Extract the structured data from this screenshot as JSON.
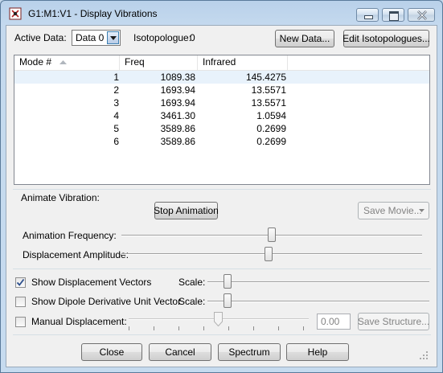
{
  "window": {
    "title": "G1:M1:V1 - Display Vibrations"
  },
  "top": {
    "active_data_label": "Active Data:",
    "active_data_value": "Data 0",
    "isotopologue_label": "Isotopologue:",
    "isotopologue_value": "0",
    "new_data_label": "New Data...",
    "edit_isotopologues_label": "Edit Isotopologues..."
  },
  "table": {
    "columns": [
      "Mode #",
      "Freq",
      "Infrared"
    ],
    "rows": [
      {
        "mode": "1",
        "freq": "1089.38",
        "infrared": "145.4275"
      },
      {
        "mode": "2",
        "freq": "1693.94",
        "infrared": "13.5571"
      },
      {
        "mode": "3",
        "freq": "1693.94",
        "infrared": "13.5571"
      },
      {
        "mode": "4",
        "freq": "3461.30",
        "infrared": "1.0594"
      },
      {
        "mode": "5",
        "freq": "3589.86",
        "infrared": "0.2699"
      },
      {
        "mode": "6",
        "freq": "3589.86",
        "infrared": "0.2699"
      }
    ]
  },
  "animate": {
    "group_label": "Animate Vibration:",
    "stop_animation_label": "Stop Animation",
    "save_movie_label": "Save Movie...",
    "frequency_label": "Animation Frequency:",
    "frequency_level": 0.5,
    "amplitude_label": "Displacement Amplitude:",
    "amplitude_level": 0.49
  },
  "options": {
    "show_vectors_label": "Show Displacement Vectors",
    "show_vectors_checked": true,
    "show_vectors_scale_label": "Scale:",
    "show_dipole_label": "Show Dipole Derivative Unit Vector",
    "show_dipole_checked": false,
    "show_dipole_scale_label": "Scale:",
    "manual_label": "Manual Displacement:",
    "manual_checked": false,
    "manual_value": "0.00",
    "save_structure_label": "Save Structure..."
  },
  "footer": {
    "close_label": "Close",
    "cancel_label": "Cancel",
    "spectrum_label": "Spectrum",
    "help_label": "Help"
  },
  "colors": {
    "frame": "#c4d9ee",
    "client": "#f0f0f0",
    "selection": "#e8f2fb"
  }
}
